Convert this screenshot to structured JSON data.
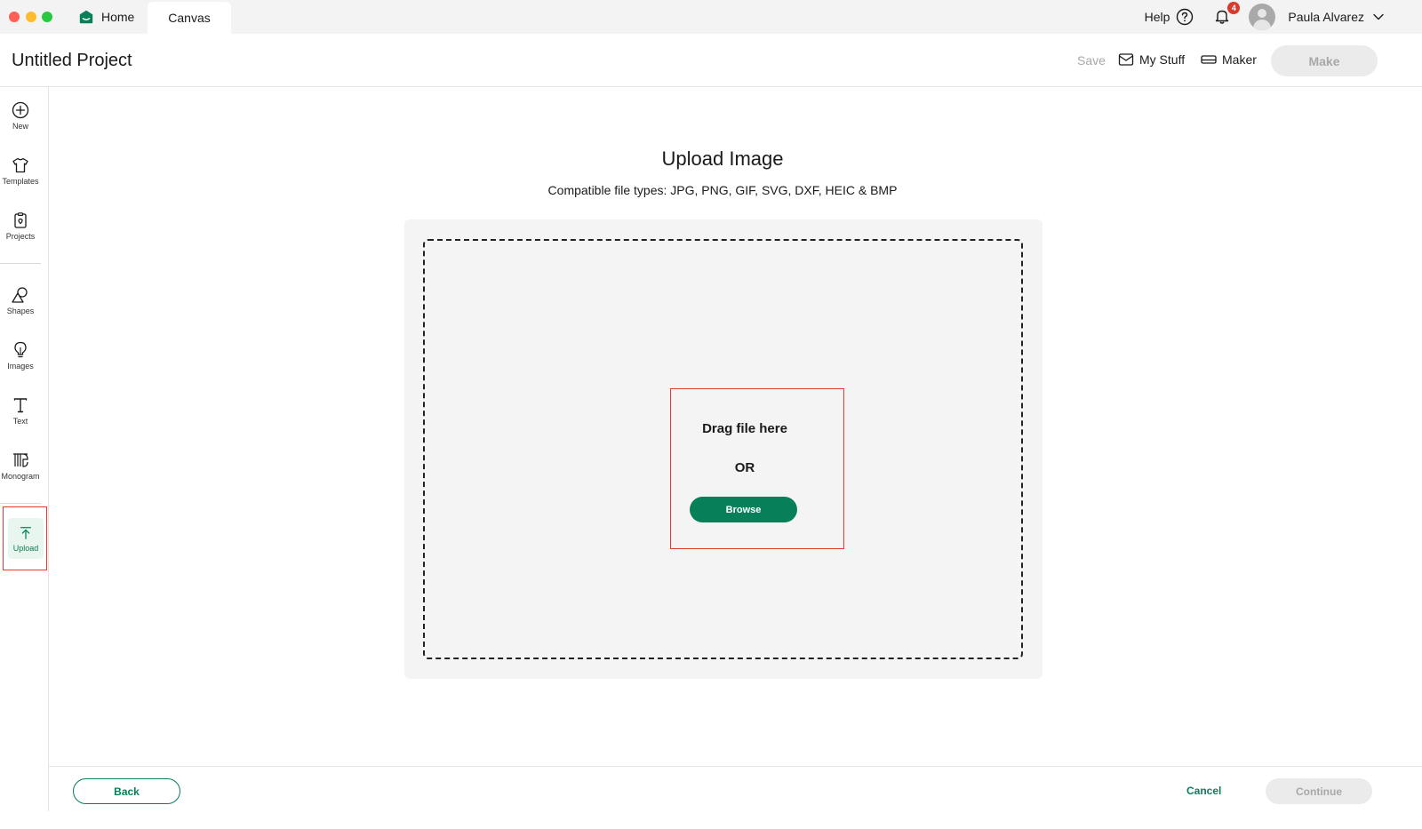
{
  "tabs": {
    "home_label": "Home",
    "canvas_label": "Canvas"
  },
  "topbar": {
    "help_label": "Help",
    "notifications_count": "4",
    "user_name": "Paula Alvarez"
  },
  "project": {
    "title": "Untitled Project",
    "save_label": "Save",
    "my_stuff_label": "My Stuff",
    "maker_label": "Maker",
    "make_label": "Make"
  },
  "sidebar": {
    "items": [
      {
        "label": "New",
        "icon": "plus-circle-icon"
      },
      {
        "label": "Templates",
        "icon": "shirt-icon"
      },
      {
        "label": "Projects",
        "icon": "clipboard-icon"
      },
      {
        "label": "Shapes",
        "icon": "shapes-icon"
      },
      {
        "label": "Images",
        "icon": "lightbulb-icon"
      },
      {
        "label": "Text",
        "icon": "text-icon"
      },
      {
        "label": "Monogram",
        "icon": "monogram-icon"
      },
      {
        "label": "Upload",
        "icon": "upload-arrow-icon"
      }
    ],
    "active": "Upload"
  },
  "upload": {
    "title": "Upload Image",
    "compatible_types": "Compatible file types:  JPG, PNG, GIF, SVG, DXF, HEIC & BMP",
    "drag_text": "Drag file here",
    "or_text": "OR",
    "browse_label": "Browse"
  },
  "footer": {
    "back_label": "Back",
    "cancel_label": "Cancel",
    "continue_label": "Continue"
  },
  "colors": {
    "brand_green": "#07805a",
    "highlight_red": "#e23b2e",
    "disabled_gray": "#ebebeb",
    "notification_red": "#d93a2b"
  }
}
